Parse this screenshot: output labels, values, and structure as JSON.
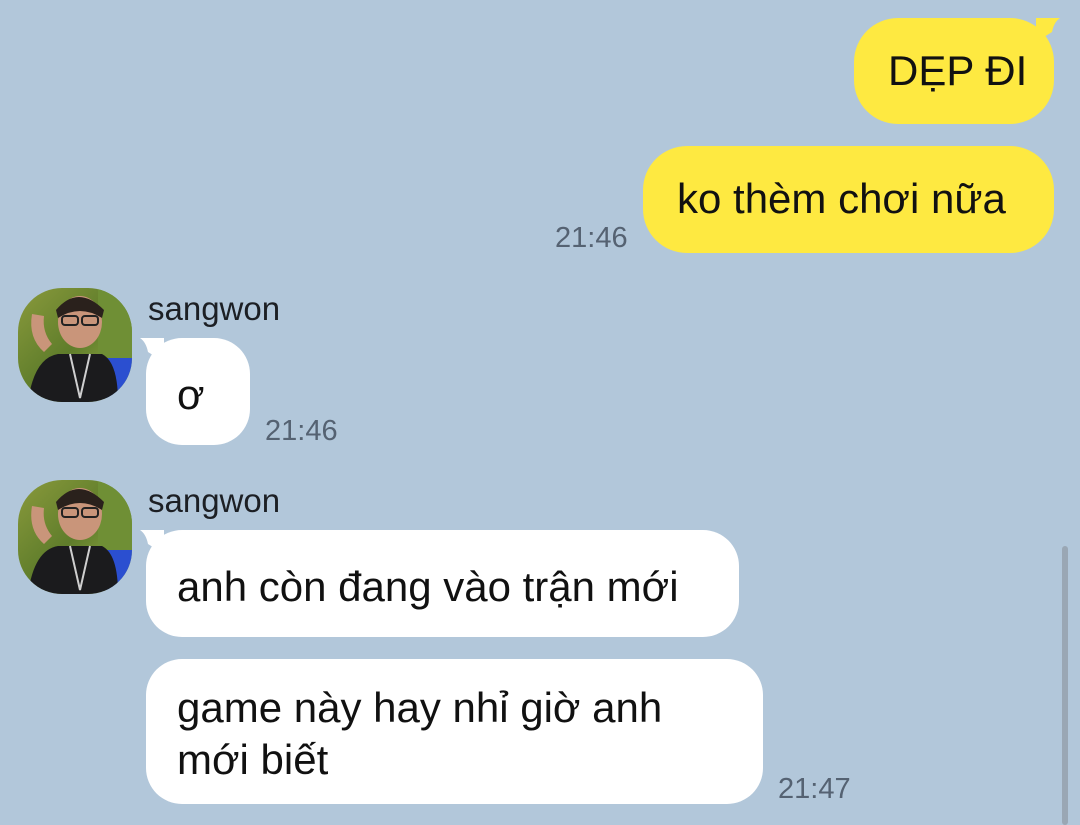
{
  "chat": {
    "outgoing_group": {
      "messages": [
        {
          "text": "DẸP ĐI"
        },
        {
          "text": "ko thèm chơi nữa"
        }
      ],
      "time": "21:46"
    },
    "incoming_group_1": {
      "sender": "sangwon",
      "messages": [
        {
          "text": "ơ"
        }
      ],
      "time": "21:46"
    },
    "incoming_group_2": {
      "sender": "sangwon",
      "messages": [
        {
          "text": "anh còn đang vào trận mới"
        },
        {
          "line1": "game này hay nhỉ giờ anh",
          "line2": "mới biết"
        }
      ],
      "time": "21:47"
    }
  },
  "colors": {
    "background": "#b2c7da",
    "outgoing_bubble": "#fee941",
    "incoming_bubble": "#ffffff",
    "timestamp": "#556272"
  }
}
